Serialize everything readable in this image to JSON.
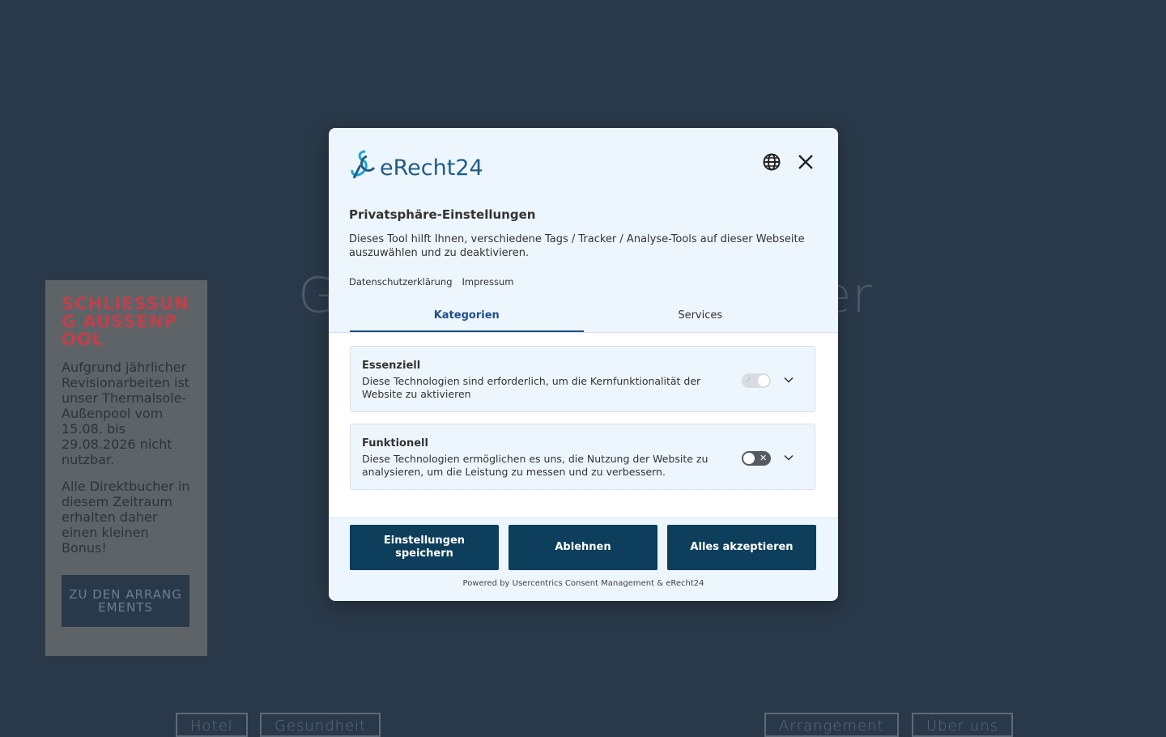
{
  "background": {
    "hero_left": "G",
    "hero_right": "er",
    "notice": {
      "title": "SCHLIESSUNG AUSSENPOOL",
      "text1": "Aufgrund jährlicher Revisionarbeiten ist unser Thermalsole-Außenpool vom 15.08. bis 29.08.2026 nicht nutzbar.",
      "text2": "Alle Direktbucher in diesem Zeitraum erhalten daher einen kleinen Bonus!",
      "button": "ZU DEN ARRANGEMENTS"
    },
    "nav": [
      "Hotel",
      "Gesundheit",
      "Arrangement",
      "Über uns"
    ]
  },
  "modal": {
    "logo_text": "eRecht24",
    "title": "Privatsphäre-Einstellungen",
    "description": "Dieses Tool hilft Ihnen, verschiedene Tags / Tracker / Analyse-Tools auf dieser Webseite auszuwählen und zu deaktivieren.",
    "links": [
      "Datenschutzerklärung",
      "Impressum"
    ],
    "tabs": [
      "Kategorien",
      "Services"
    ],
    "categories": [
      {
        "title": "Essenziell",
        "description": "Diese Technologien sind erforderlich, um die Kernfunktionalität der Website zu aktivieren",
        "toggle_mark": "✓"
      },
      {
        "title": "Funktionell",
        "description": "Diese Technologien ermöglichen es uns, die Nutzung der Website zu analysieren, um die Leistung zu messen und zu verbessern.",
        "toggle_mark": "✕"
      }
    ],
    "buttons": {
      "save": "Einstellungen speichern",
      "deny": "Ablehnen",
      "accept": "Alles akzeptieren"
    },
    "powered_by": "Powered by Usercentrics Consent Management & eRecht24"
  },
  "colors": {
    "primary": "#0d3e5c",
    "overlay": "#2a3949",
    "accent_tab": "#1e4f8c"
  }
}
